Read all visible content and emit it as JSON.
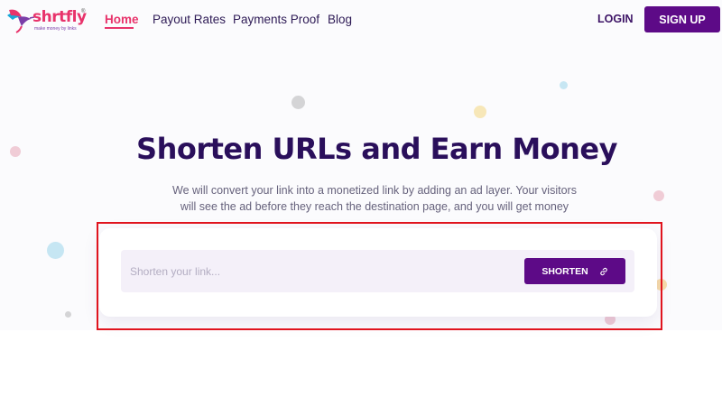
{
  "brand": {
    "logo_text": "shrtfly",
    "tagline": "make money by links",
    "reg_mark": "®",
    "primary_color": "#5d0a87",
    "accent_color": "#e8336b"
  },
  "nav": {
    "items": [
      {
        "label": "Home",
        "active": true
      },
      {
        "label": "Payout Rates",
        "active": false
      },
      {
        "label": "Payments Proof",
        "active": false
      },
      {
        "label": "Blog",
        "active": false
      }
    ],
    "login_label": "LOGIN",
    "signup_label": "SIGN UP"
  },
  "hero": {
    "title": "Shorten URLs and Earn Money",
    "subtitle": "We will convert your link into a monetized link by adding an ad layer. Your visitors will see the ad before they reach the destination page, and you will get money"
  },
  "shortener": {
    "placeholder": "Shorten your link...",
    "value": "",
    "button_label": "SHORTEN",
    "button_icon": "link-icon"
  },
  "highlight_color": "#e0141e"
}
